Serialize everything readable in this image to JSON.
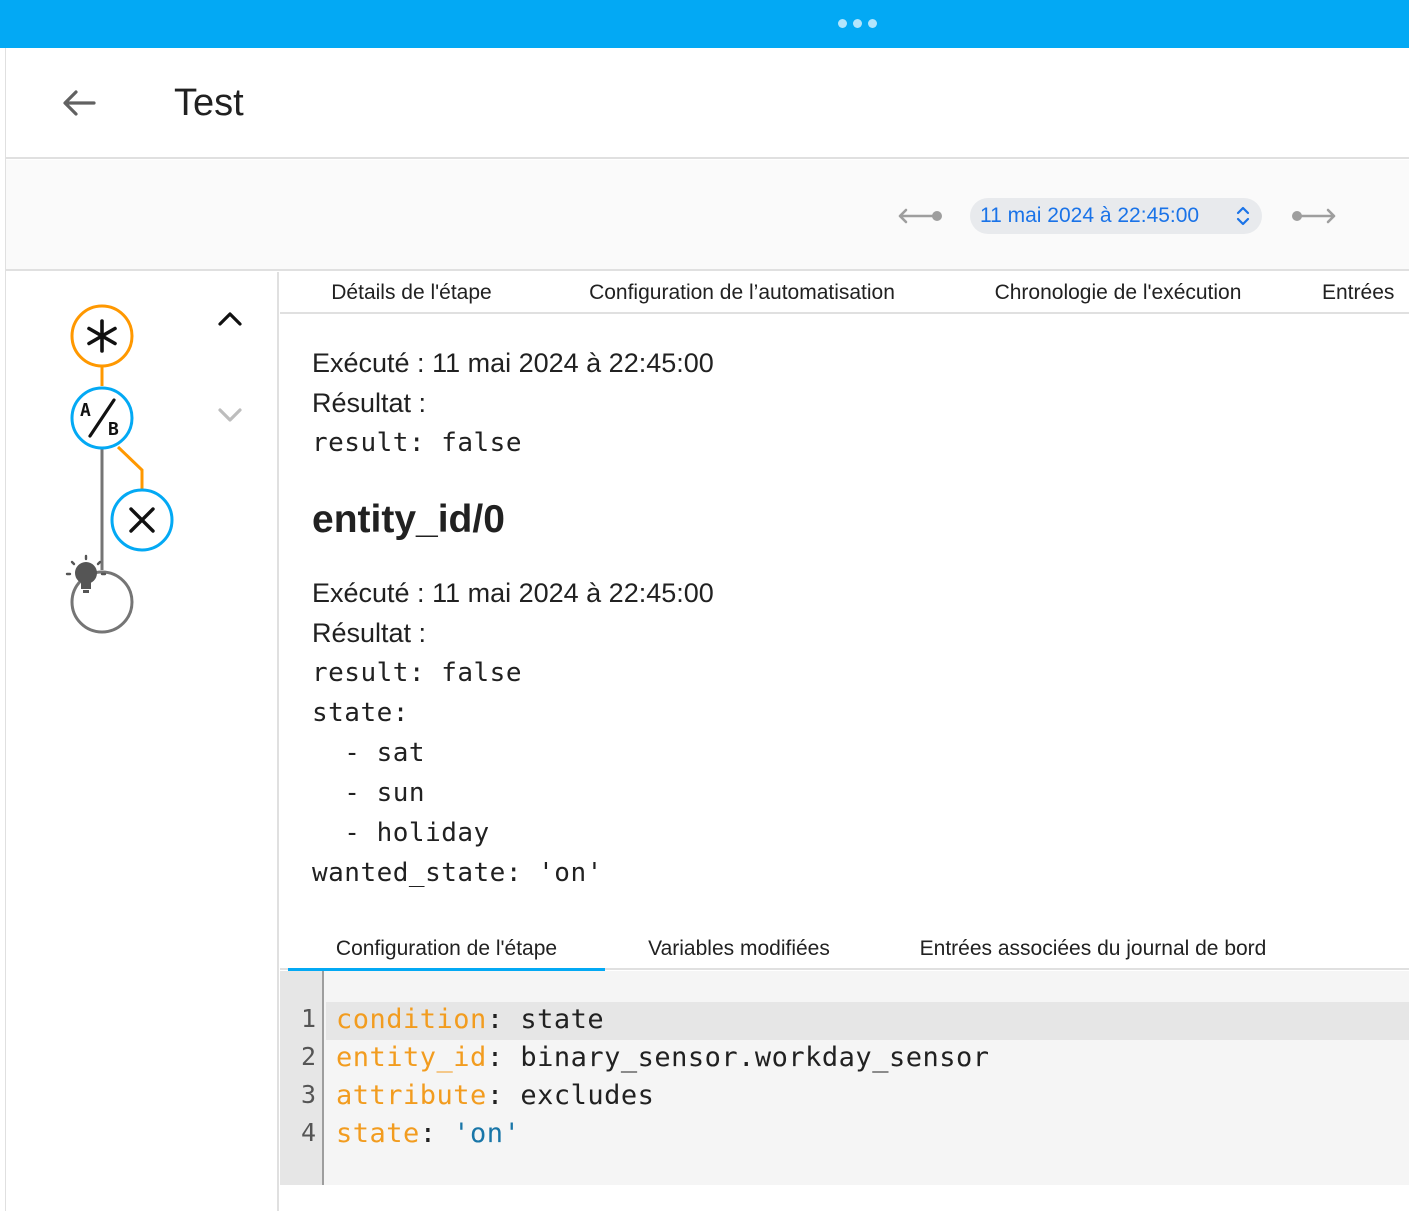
{
  "header": {
    "title": "Test"
  },
  "toolbar": {
    "run_selector_value": "11 mai 2024 à 22:45:00"
  },
  "tabs": [
    {
      "label": "Détails de l'étape",
      "active": true
    },
    {
      "label": "Configuration de l’automatisation",
      "active": false
    },
    {
      "label": "Chronologie de l'exécution",
      "active": false
    },
    {
      "label": "Entrées",
      "active": false
    }
  ],
  "details": {
    "block1": {
      "executed": "Exécuté : 11 mai 2024 à 22:45:00",
      "result_label": "Résultat :",
      "result_line": "result: false"
    },
    "section_title": "entity_id/0",
    "block2": {
      "executed": "Exécuté : 11 mai 2024 à 22:45:00",
      "result_label": "Résultat :",
      "lines": [
        "result: false",
        "state:",
        "  - sat",
        "  - sun",
        "  - holiday",
        "wanted_state: 'on'"
      ]
    }
  },
  "bottom_tabs": [
    {
      "label": "Configuration de l'étape",
      "active": true
    },
    {
      "label": "Variables modifiées",
      "active": false
    },
    {
      "label": "Entrées associées du journal de bord",
      "active": false
    }
  ],
  "editor": {
    "lines": [
      {
        "num": "1",
        "key": "condition",
        "sep": ": ",
        "value": "state",
        "value_is_string": false
      },
      {
        "num": "2",
        "key": "entity_id",
        "sep": ": ",
        "value": "binary_sensor.workday_sensor",
        "value_is_string": false
      },
      {
        "num": "3",
        "key": "attribute",
        "sep": ": ",
        "value": "excludes",
        "value_is_string": false
      },
      {
        "num": "4",
        "key": "state",
        "sep": ": ",
        "value": "'on'",
        "value_is_string": true
      }
    ]
  },
  "graph": {
    "nodes": [
      {
        "type": "trigger",
        "icon": "asterisk-icon",
        "color": "#ff9800"
      },
      {
        "type": "condition",
        "icon": "ab-testing-icon",
        "color": "#03a9f4"
      },
      {
        "type": "stop",
        "icon": "close-icon",
        "color": "#03a9f4"
      },
      {
        "type": "action",
        "icon": "lightbulb-icon",
        "color": "#757575"
      }
    ]
  },
  "colors": {
    "accent": "#03a9f4",
    "trace_active": "#ff9800",
    "yaml_key": "#f29c1f",
    "yaml_string": "#1976a8"
  }
}
